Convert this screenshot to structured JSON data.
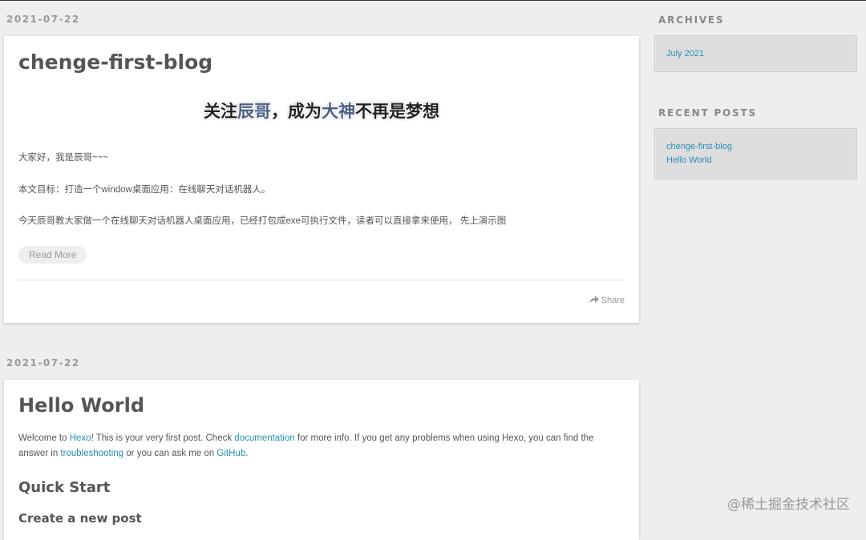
{
  "posts": [
    {
      "date": "2021-07-22",
      "title": "chenge-first-blog",
      "banner": {
        "part1": "关注",
        "part2": "辰哥",
        "part3": "，成为",
        "part4": "大神",
        "part5": "不再是梦想"
      },
      "paragraphs": [
        "大家好，我是辰哥~~~",
        "本文目标：打造一个window桌面应用：在线聊天对话机器人。",
        "今天辰哥教大家做一个在线聊天对话机器人桌面应用，已经打包成exe可执行文件，读者可以直接拿来使用， 先上演示图"
      ],
      "read_more": "Read More",
      "share": "Share"
    },
    {
      "date": "2021-07-22",
      "title": "Hello World",
      "intro": {
        "t1": "Welcome to ",
        "l1": "Hexo",
        "t2": "! This is your very first post. Check ",
        "l2": "documentation",
        "t3": " for more info. If you get any problems when using Hexo, you can find the answer in ",
        "l3": "troubleshooting",
        "t4": " or you can ask me on ",
        "l4": "GitHub",
        "t5": "."
      },
      "h2": "Quick Start",
      "h3": "Create a new post"
    }
  ],
  "sidebar": {
    "archives": {
      "title": "ARCHIVES",
      "items": [
        "July 2021"
      ]
    },
    "recent": {
      "title": "RECENT POSTS",
      "items": [
        "chenge-first-blog",
        "Hello World"
      ]
    }
  },
  "watermark": "@稀土掘金技术社区",
  "colors": {
    "link": "#258fb8",
    "background": "#eeeeee",
    "card": "#ffffff"
  },
  "icons": {
    "share": "share-arrow-icon"
  }
}
